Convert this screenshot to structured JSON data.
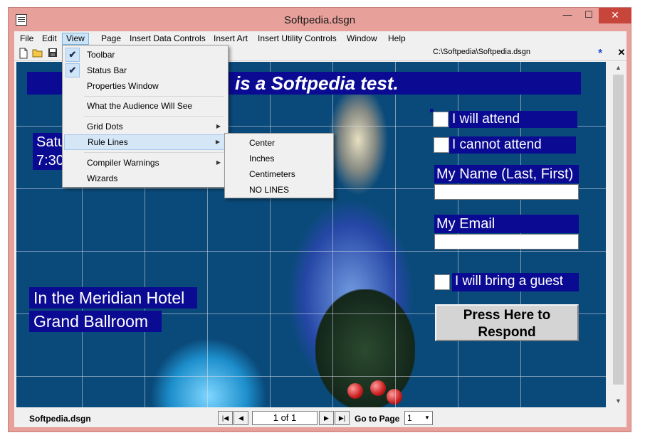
{
  "window": {
    "title": "Softpedia.dsgn"
  },
  "titlebar_buttons": {
    "minimize": "—",
    "maximize": "☐",
    "close": "✕"
  },
  "menubar": {
    "items": [
      "File",
      "Edit",
      "View",
      "Page",
      "Insert Data Controls",
      "Insert Art",
      "Insert Utility Controls",
      "Window",
      "Help"
    ]
  },
  "toolbar": {
    "path": "C:\\Softpedia\\Softpedia.dsgn",
    "star": "*",
    "close": "✕"
  },
  "view_menu": {
    "items": [
      {
        "label": "Toolbar",
        "checked": true
      },
      {
        "label": "Status Bar",
        "checked": true
      },
      {
        "label": "Properties Window"
      },
      {
        "label": "What the Audience Will See"
      },
      {
        "label": "Grid Dots",
        "submenu": true
      },
      {
        "label": "Rule Lines",
        "submenu": true,
        "highlighted": true
      },
      {
        "label": "Compiler Warnings",
        "submenu": true
      },
      {
        "label": "Wizards"
      }
    ]
  },
  "rule_lines_submenu": {
    "items": [
      "Center",
      "Inches",
      "Centimeters",
      "NO LINES"
    ]
  },
  "design": {
    "headline": "is a Softpedia test.",
    "date_lines": [
      "Satu",
      "7:30"
    ],
    "venue_line1": "In the Meridian Hotel",
    "venue_line2": "Grand Ballroom",
    "attend_label": "I will attend",
    "not_attend_label": "I cannot attend",
    "name_label": "My Name (Last, First)",
    "email_label": "My Email",
    "guest_label": "I will bring a guest",
    "respond_button_line1": "Press Here to",
    "respond_button_line2": "Respond"
  },
  "statusbar": {
    "filename": "Softpedia.dsgn",
    "page_indicator": "1 of 1",
    "goto_label": "Go to Page",
    "goto_value": "1"
  },
  "colors": {
    "title_bar": "#e8a09a",
    "text_box_bg": "#0a0a92",
    "close_button": "#c7453b",
    "menu_highlight": "#d5e6f7"
  }
}
